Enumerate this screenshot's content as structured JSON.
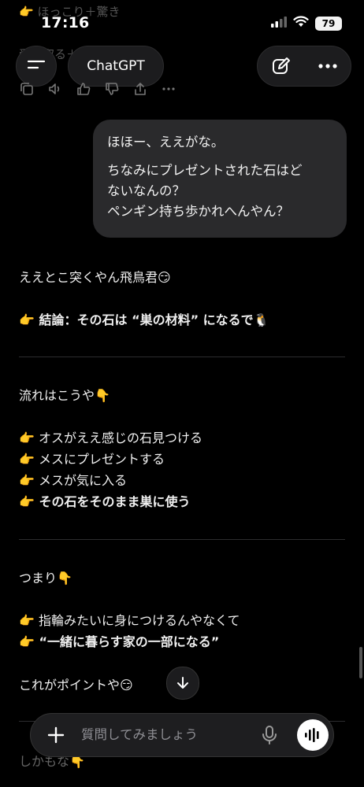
{
  "status_bar": {
    "time": "17:16",
    "battery": "79"
  },
  "ghost_top": {
    "line1": "👉 ほっこり＋驚き",
    "line2": "受け取る＋巣作り"
  },
  "header": {
    "title": "ChatGPT"
  },
  "user_message": {
    "line1": "ほほー、ええがな。",
    "line2": "ちなみにプレゼントされた石はど",
    "line3": "ないなんの？",
    "line4": "ペンギン持ち歩かれへんやん？"
  },
  "assistant": {
    "intro": "ええとこ突くやん飛鳥君😏",
    "conclusion": "👉 結論：その石は “巣の材料” になるで🐧",
    "flow_heading": "流れはこうや👇",
    "flow_items": [
      "👉 オスがええ感じの石見つける",
      "👉 メスにプレゼントする",
      "👉 メスが気に入る",
      "👉 その石をそのまま巣に使う"
    ],
    "summary_heading": "つまり👇",
    "summary_items": [
      "👉 指輪みたいに身につけるんやなくて",
      "👉 “一緒に暮らす家の一部になる”"
    ],
    "point": "これがポイントや😏",
    "trailing": "しかもな👇"
  },
  "composer": {
    "placeholder": "質問してみましょう"
  }
}
